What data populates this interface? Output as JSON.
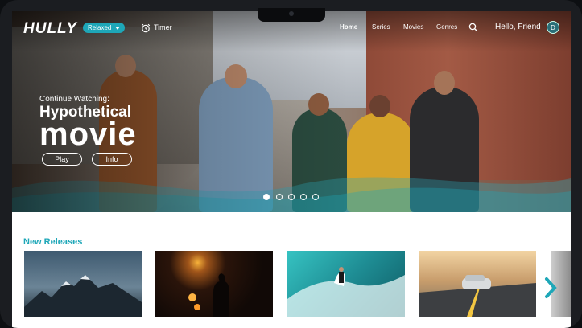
{
  "app": {
    "logo": "HULLY"
  },
  "nav": {
    "mood": "Relaxed",
    "timer": "Timer",
    "links": [
      "Home",
      "Series",
      "Movies",
      "Genres"
    ],
    "active_link": "Home",
    "greeting": "Hello, Friend",
    "avatar_initial": "D"
  },
  "hero": {
    "eyebrow": "Continue Watching:",
    "title_line1": "Hypothetical",
    "title_line2": "movie",
    "play_label": "Play",
    "info_label": "Info",
    "slide_count": 5,
    "active_slide": 1
  },
  "new_releases": {
    "title": "New Releases",
    "items": [
      {
        "icon": "mountain-thumbnail"
      },
      {
        "icon": "silhouette-lights-thumbnail"
      },
      {
        "icon": "surfer-wave-thumbnail"
      },
      {
        "icon": "car-road-thumbnail"
      }
    ]
  },
  "colors": {
    "accent": "#1ea7b8",
    "text": "#ffffff"
  }
}
